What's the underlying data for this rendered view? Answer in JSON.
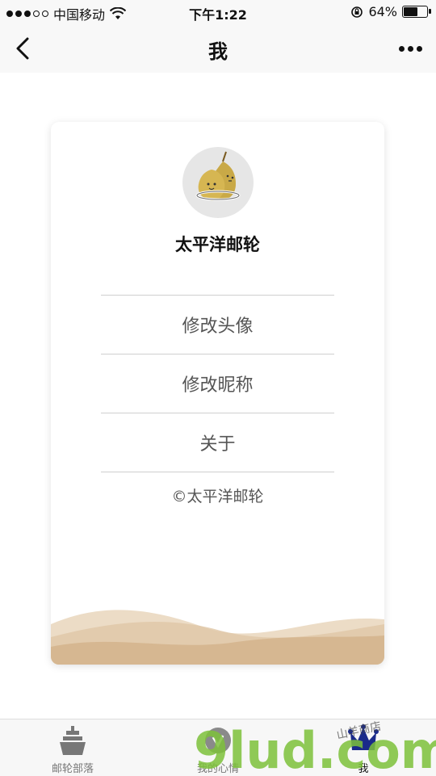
{
  "status_bar": {
    "carrier": "中国移动",
    "time": "下午1:22",
    "battery_text": "64%",
    "battery_level": 0.64,
    "signal_bars_filled": 3,
    "signal_bars_total": 5
  },
  "nav": {
    "title": "我",
    "back_icon": "chevron-left-icon",
    "more_icon": "more-dots-icon"
  },
  "profile": {
    "name": "太平洋邮轮",
    "avatar_icon": "pear-avatar"
  },
  "menu": {
    "items": [
      {
        "label": "修改头像"
      },
      {
        "label": "修改昵称"
      },
      {
        "label": "关于"
      }
    ],
    "copyright": "©太平洋邮轮"
  },
  "tabs": [
    {
      "label": "邮轮部落",
      "icon": "ship-icon"
    },
    {
      "label": "我的心情",
      "icon": "mood-icon"
    },
    {
      "label": "我",
      "icon": "crown-icon"
    }
  ],
  "watermark": {
    "logo_text": "9lud.com",
    "handwriting": "山羊商店"
  },
  "colors": {
    "wave_light": "#ecdcc6",
    "wave_mid": "#e0c7a6",
    "wave_dark": "#d4b48c",
    "active_tab": "#1a2a8a",
    "inactive_tab": "#777777",
    "watermark_green": "#7cc13a"
  }
}
